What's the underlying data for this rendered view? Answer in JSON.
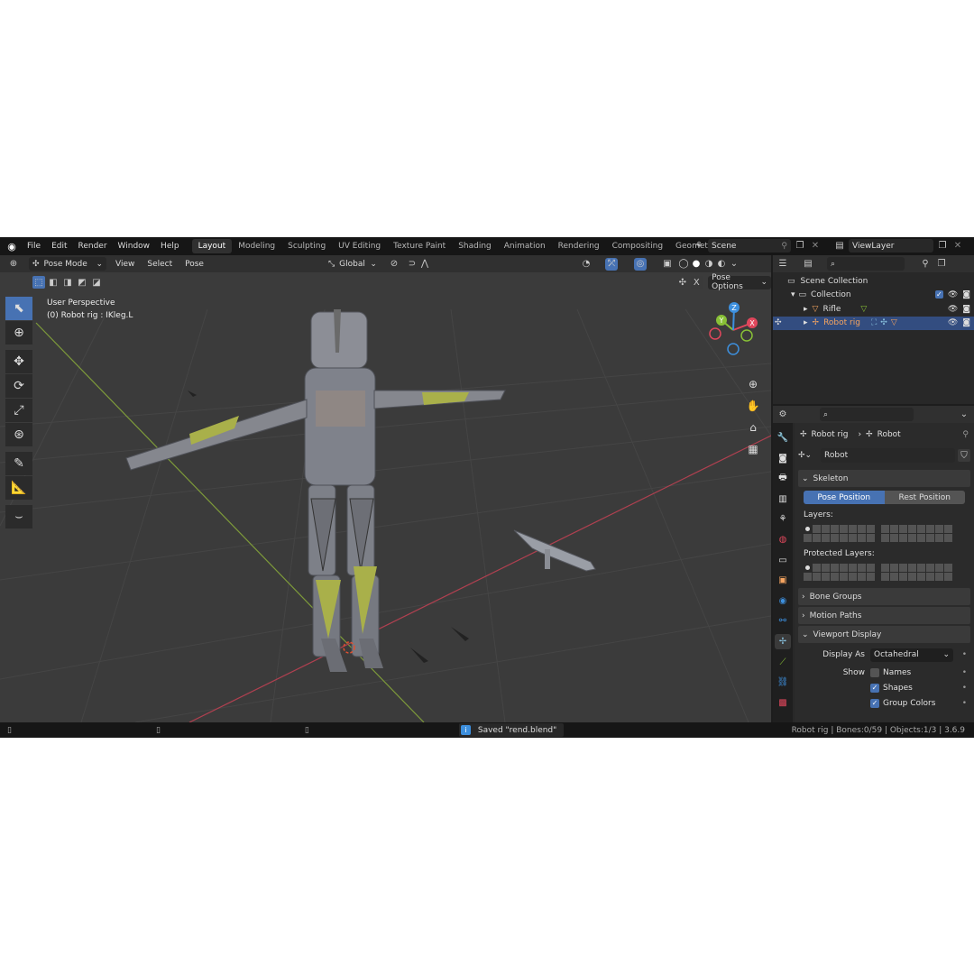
{
  "menu": {
    "items": [
      "File",
      "Edit",
      "Render",
      "Window",
      "Help"
    ]
  },
  "workspaces": {
    "tabs": [
      "Layout",
      "Modeling",
      "Sculpting",
      "UV Editing",
      "Texture Paint",
      "Shading",
      "Animation",
      "Rendering",
      "Compositing",
      "Geometry Noc"
    ],
    "active": "Layout"
  },
  "scene": {
    "name": "Scene"
  },
  "view_layer": {
    "name": "ViewLayer"
  },
  "viewport": {
    "mode": "Pose Mode",
    "menus": [
      "View",
      "Select",
      "Pose"
    ],
    "orientation": "Global",
    "pose_options": "Pose Options",
    "info_line1": "User Perspective",
    "info_line2": "(0) Robot rig : IKleg.L",
    "gizmo": {
      "x": "X",
      "y": "Y",
      "z": "Z"
    }
  },
  "outliner": {
    "root": "Scene Collection",
    "collection": "Collection",
    "items": [
      {
        "name": "Rifle"
      },
      {
        "name": "Robot rig"
      }
    ]
  },
  "properties": {
    "breadcrumb_object": "Robot rig",
    "breadcrumb_data": "Robot",
    "data_name": "Robot",
    "skeleton": {
      "title": "Skeleton",
      "pose_position": "Pose Position",
      "rest_position": "Rest Position",
      "layers_label": "Layers:",
      "protected_label": "Protected Layers:"
    },
    "bone_groups": "Bone Groups",
    "motion_paths": "Motion Paths",
    "viewport_display": {
      "title": "Viewport Display",
      "display_as_label": "Display As",
      "display_as_value": "Octahedral",
      "show_label": "Show",
      "names": "Names",
      "shapes": "Shapes",
      "group_colors": "Group Colors"
    }
  },
  "status": {
    "message": "Saved \"rend.blend\"",
    "stats": "Robot rig | Bones:0/59 | Objects:1/3 | 3.6.9"
  },
  "colors": {
    "accent": "#4772b3",
    "selected_text": "#f4a460",
    "x_axis": "#e0475c",
    "y_axis": "#88c036",
    "z_axis": "#3d8fdd"
  }
}
